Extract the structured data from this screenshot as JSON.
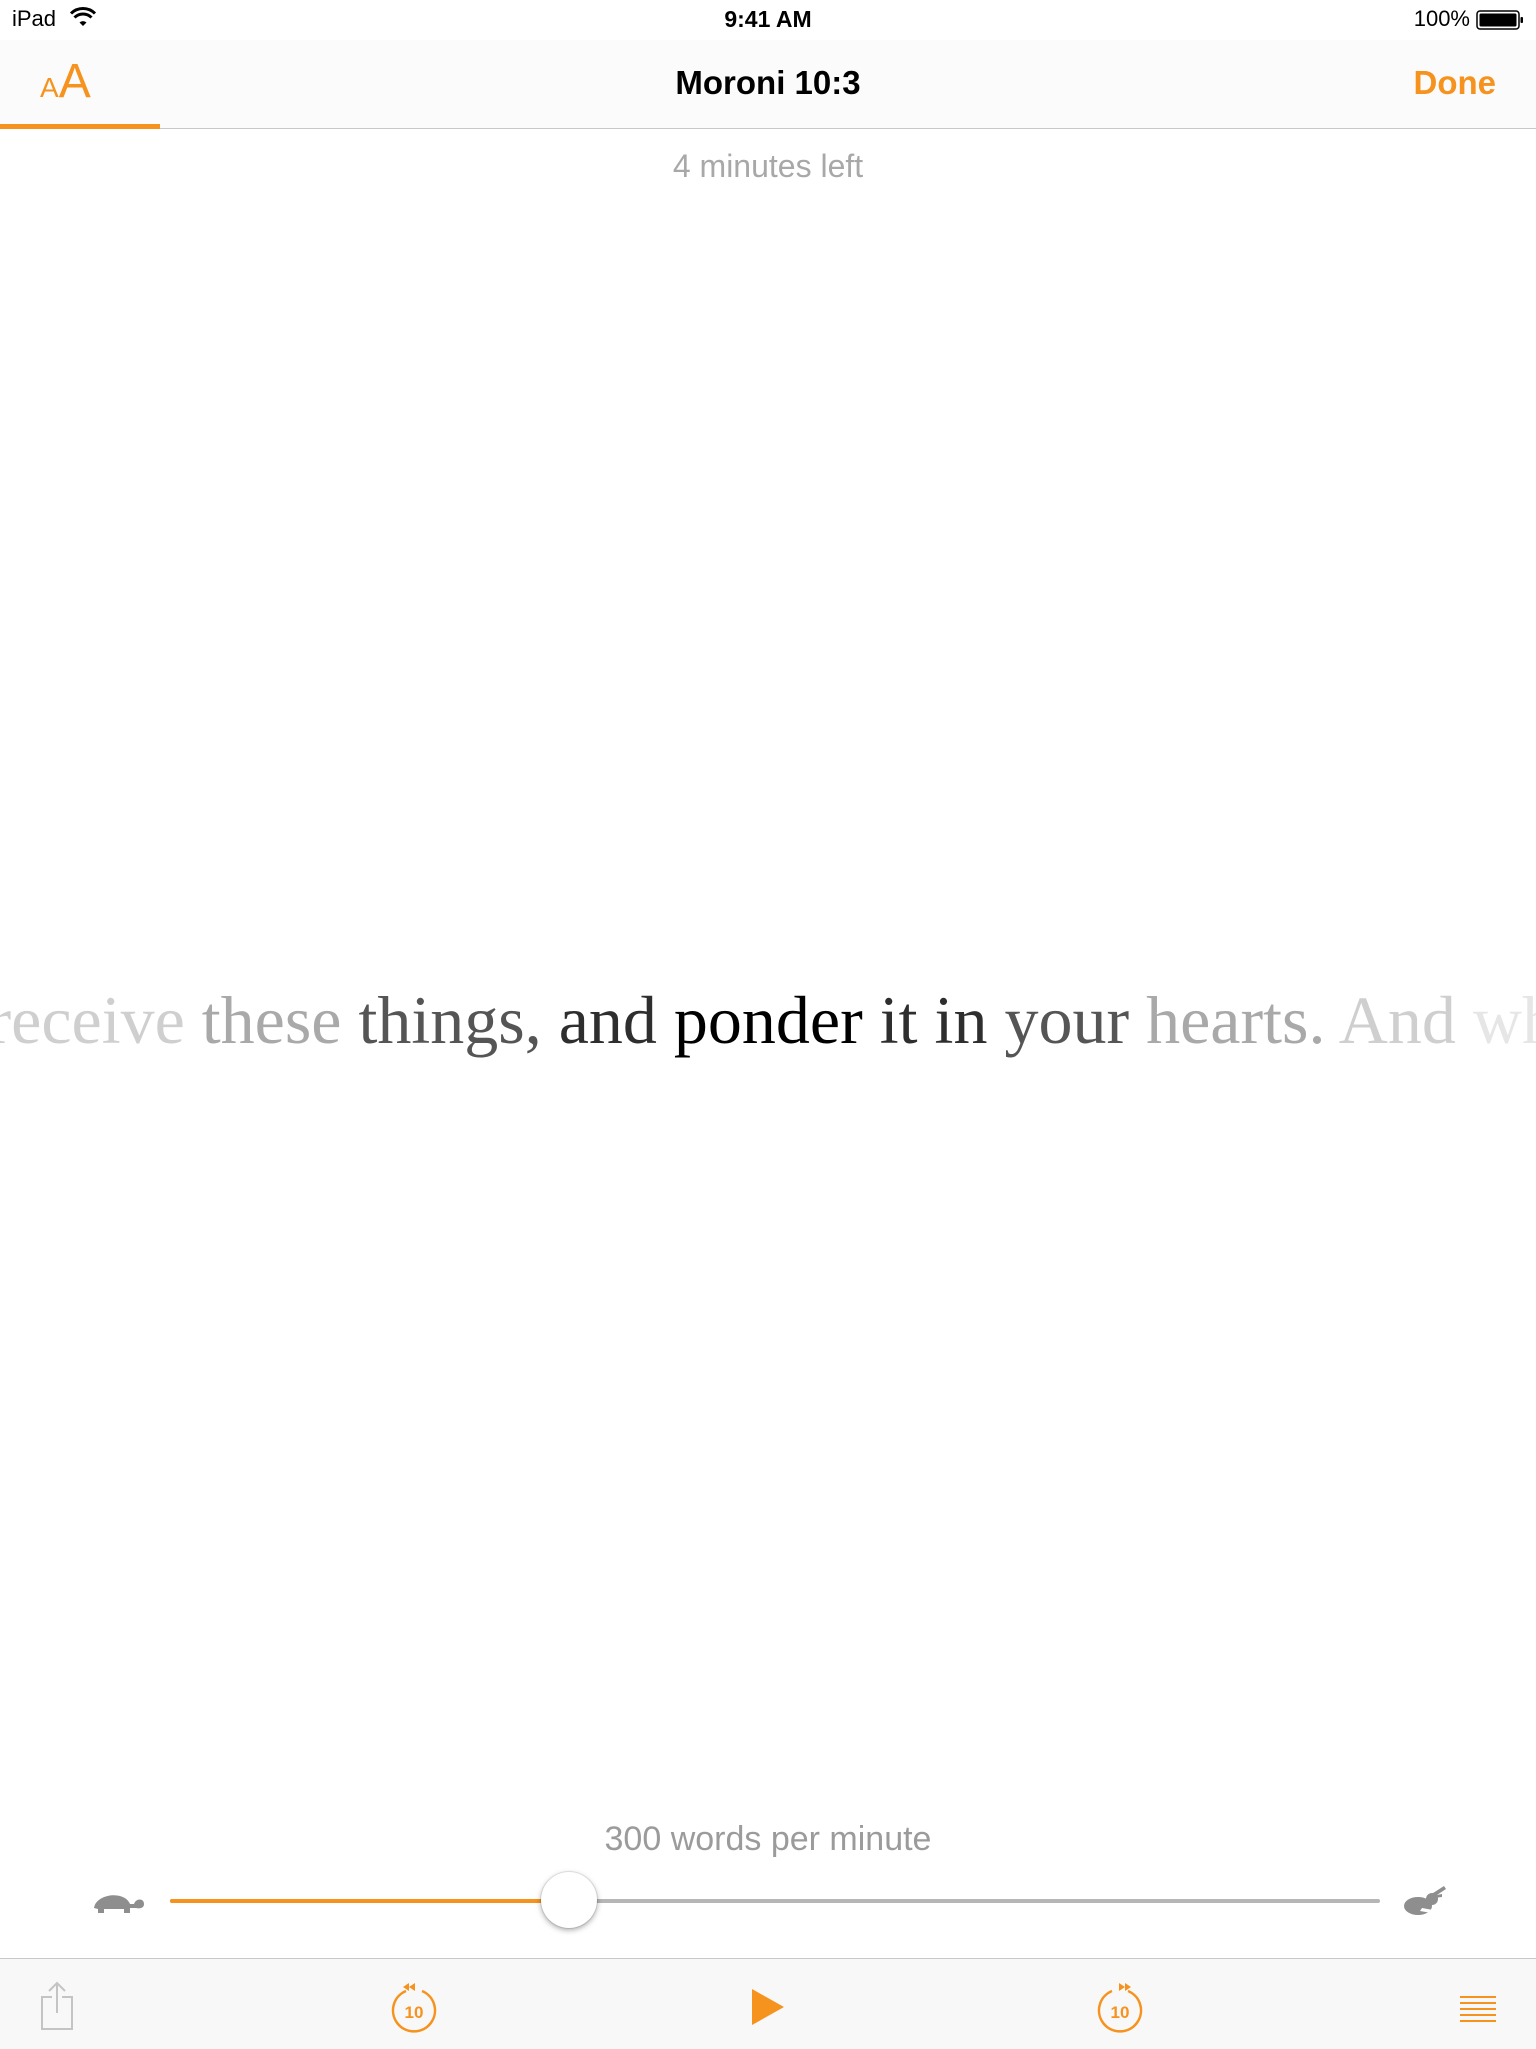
{
  "status_bar": {
    "device": "iPad",
    "time": "9:41 AM",
    "battery": "100%"
  },
  "nav": {
    "font_size_small": "A",
    "font_size_large": "A",
    "title": "Moroni 10:3",
    "done_label": "Done"
  },
  "progress": {
    "time_left": "4 minutes left"
  },
  "reader": {
    "words": [
      "receive",
      "these",
      "things,",
      "and",
      "ponder",
      "it",
      "in",
      "your",
      "hearts.",
      "And",
      "wh"
    ]
  },
  "speed": {
    "label": "300 words per minute",
    "slider_fraction": 0.33,
    "slow_icon": "turtle-icon",
    "fast_icon": "rabbit-icon"
  },
  "toolbar": {
    "rewind_seconds": "10",
    "forward_seconds": "10",
    "icons": [
      "share-icon",
      "rewind-10-icon",
      "play-icon",
      "forward-10-icon",
      "list-icon"
    ]
  },
  "colors": {
    "accent": "#f6921e",
    "muted_text": "#a8a8a8"
  }
}
